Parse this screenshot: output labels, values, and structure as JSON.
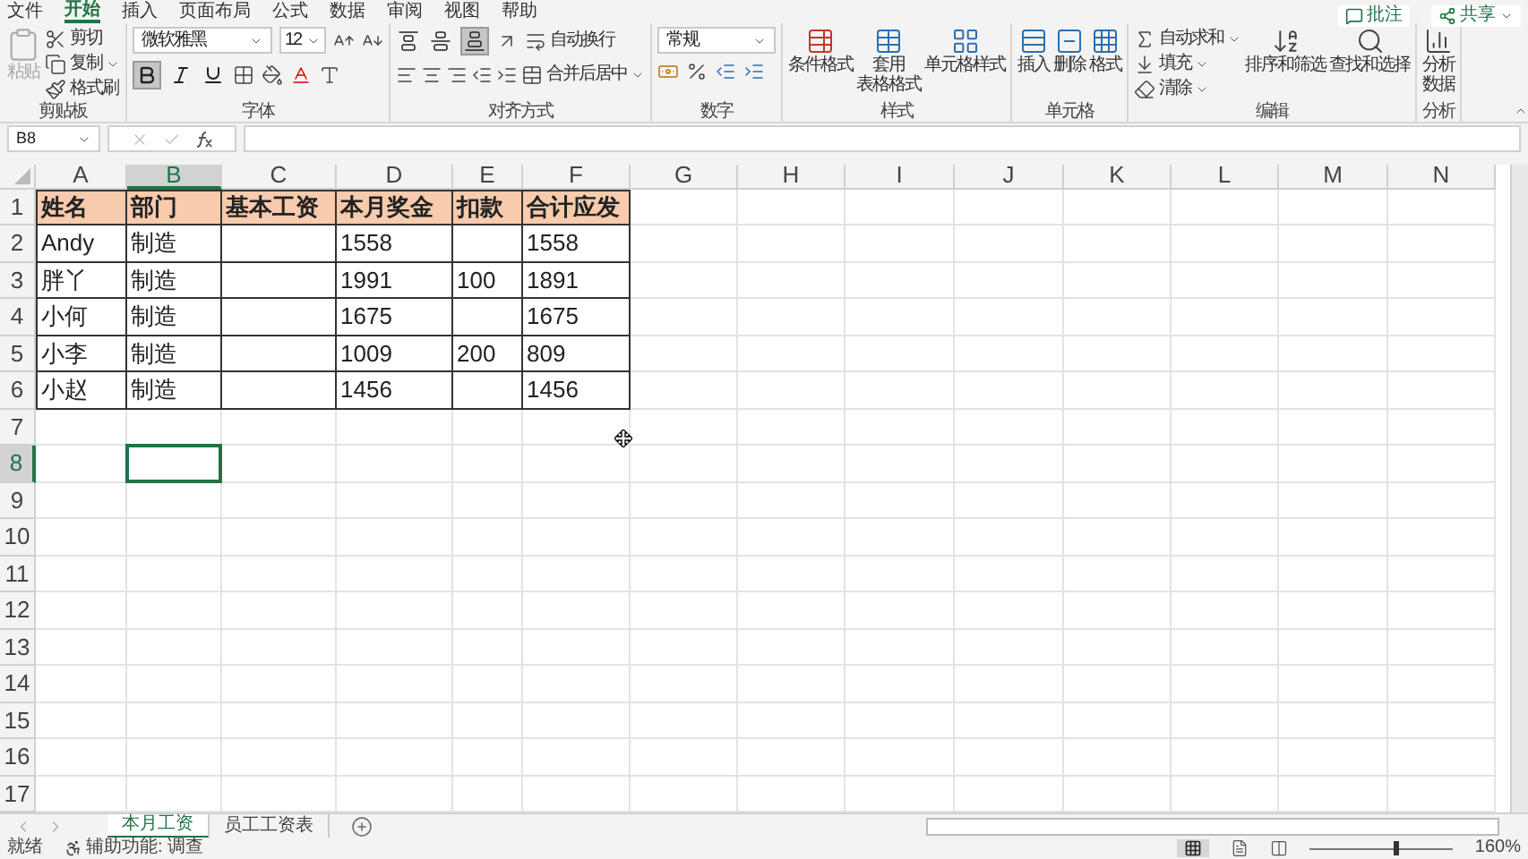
{
  "menu_tabs": [
    {
      "label": "文件",
      "selected": false
    },
    {
      "label": "开始",
      "selected": true
    },
    {
      "label": "插入",
      "selected": false
    },
    {
      "label": "页面布局",
      "selected": false
    },
    {
      "label": "公式",
      "selected": false
    },
    {
      "label": "数据",
      "selected": false
    },
    {
      "label": "审阅",
      "selected": false
    },
    {
      "label": "视图",
      "selected": false
    },
    {
      "label": "帮助",
      "selected": false
    }
  ],
  "top_buttons": {
    "comments": "批注",
    "share": "共享"
  },
  "clipboard": {
    "label": "剪贴板",
    "paste": {
      "label": "粘贴",
      "disabled": true
    },
    "cut": "剪切",
    "copy": "复制",
    "format_painter": "格式刷"
  },
  "font": {
    "label": "字体",
    "name": "微软雅黑",
    "size": "12",
    "bold": true,
    "italic": false,
    "underline": false
  },
  "alignment": {
    "label": "对齐方式",
    "vertical": [
      {
        "selected": false
      },
      {
        "selected": false
      },
      {
        "selected": true
      }
    ],
    "wrap_text": "自动换行",
    "merge_center": "合并后居中"
  },
  "number": {
    "label": "数字",
    "format": "常规"
  },
  "styles": {
    "label": "样式",
    "buttons": [
      {
        "lines": [
          "条件格式"
        ]
      },
      {
        "lines": [
          "套用",
          "表格格式"
        ]
      },
      {
        "lines": [
          "单元格样式"
        ]
      }
    ]
  },
  "cells": {
    "label": "单元格",
    "buttons": [
      "插入",
      "删除",
      "格式"
    ]
  },
  "editing": {
    "label": "编辑",
    "autosum": "自动求和",
    "fill": "填充",
    "clear": "清除",
    "sort_filter": "排序和筛选",
    "find_select": "查找和选择"
  },
  "analysis": {
    "label": "分析",
    "button": [
      "分析",
      "数据"
    ]
  },
  "formula_bar": {
    "name_box": "B8"
  },
  "sheet": {
    "columns": [
      {
        "label": "A",
        "selected": false
      },
      {
        "label": "B",
        "selected": true
      },
      {
        "label": "C",
        "selected": false
      },
      {
        "label": "D",
        "selected": false
      },
      {
        "label": "E",
        "selected": false
      },
      {
        "label": "F",
        "selected": false
      },
      {
        "label": "G",
        "selected": false
      },
      {
        "label": "H",
        "selected": false
      },
      {
        "label": "I",
        "selected": false
      },
      {
        "label": "J",
        "selected": false
      },
      {
        "label": "K",
        "selected": false
      },
      {
        "label": "L",
        "selected": false
      },
      {
        "label": "M",
        "selected": false
      },
      {
        "label": "N",
        "selected": false
      }
    ],
    "rows": [
      {
        "label": "1",
        "selected": false,
        "kind": "header",
        "cells": [
          "姓名",
          "部门",
          "基本工资",
          "本月奖金",
          "扣款",
          "合计应发"
        ]
      },
      {
        "label": "2",
        "selected": false,
        "kind": "data",
        "cells": [
          "Andy",
          "制造",
          null,
          "1558",
          null,
          "1558"
        ]
      },
      {
        "label": "3",
        "selected": false,
        "kind": "data",
        "cells": [
          "胖丫",
          "制造",
          null,
          "1991",
          "100",
          "1891"
        ]
      },
      {
        "label": "4",
        "selected": false,
        "kind": "data",
        "cells": [
          "小何",
          "制造",
          null,
          "1675",
          null,
          "1675"
        ]
      },
      {
        "label": "5",
        "selected": false,
        "kind": "data",
        "cells": [
          "小李",
          "制造",
          null,
          "1009",
          "200",
          "809"
        ]
      },
      {
        "label": "6",
        "selected": false,
        "kind": "data",
        "cells": [
          "小赵",
          "制造",
          null,
          "1456",
          null,
          "1456"
        ]
      },
      {
        "label": "7",
        "selected": false,
        "kind": "empty"
      },
      {
        "label": "8",
        "selected": true,
        "kind": "empty"
      },
      {
        "label": "9",
        "selected": false,
        "kind": "empty"
      },
      {
        "label": "10",
        "selected": false,
        "kind": "empty"
      },
      {
        "label": "11",
        "selected": false,
        "kind": "empty"
      },
      {
        "label": "12",
        "selected": false,
        "kind": "empty"
      },
      {
        "label": "13",
        "selected": false,
        "kind": "empty"
      },
      {
        "label": "14",
        "selected": false,
        "kind": "empty"
      },
      {
        "label": "15",
        "selected": false,
        "kind": "empty"
      },
      {
        "label": "16",
        "selected": false,
        "kind": "empty"
      },
      {
        "label": "17",
        "selected": false,
        "kind": "empty"
      }
    ]
  },
  "sheet_tabs": [
    {
      "label": "本月工资",
      "selected": true
    },
    {
      "label": "员工工资表",
      "selected": false
    }
  ],
  "status_bar": {
    "mode": "就绪",
    "accessibility": "辅助功能: 调查",
    "zoom": "160%",
    "zoom_slider": {
      "level": 0.6
    }
  }
}
